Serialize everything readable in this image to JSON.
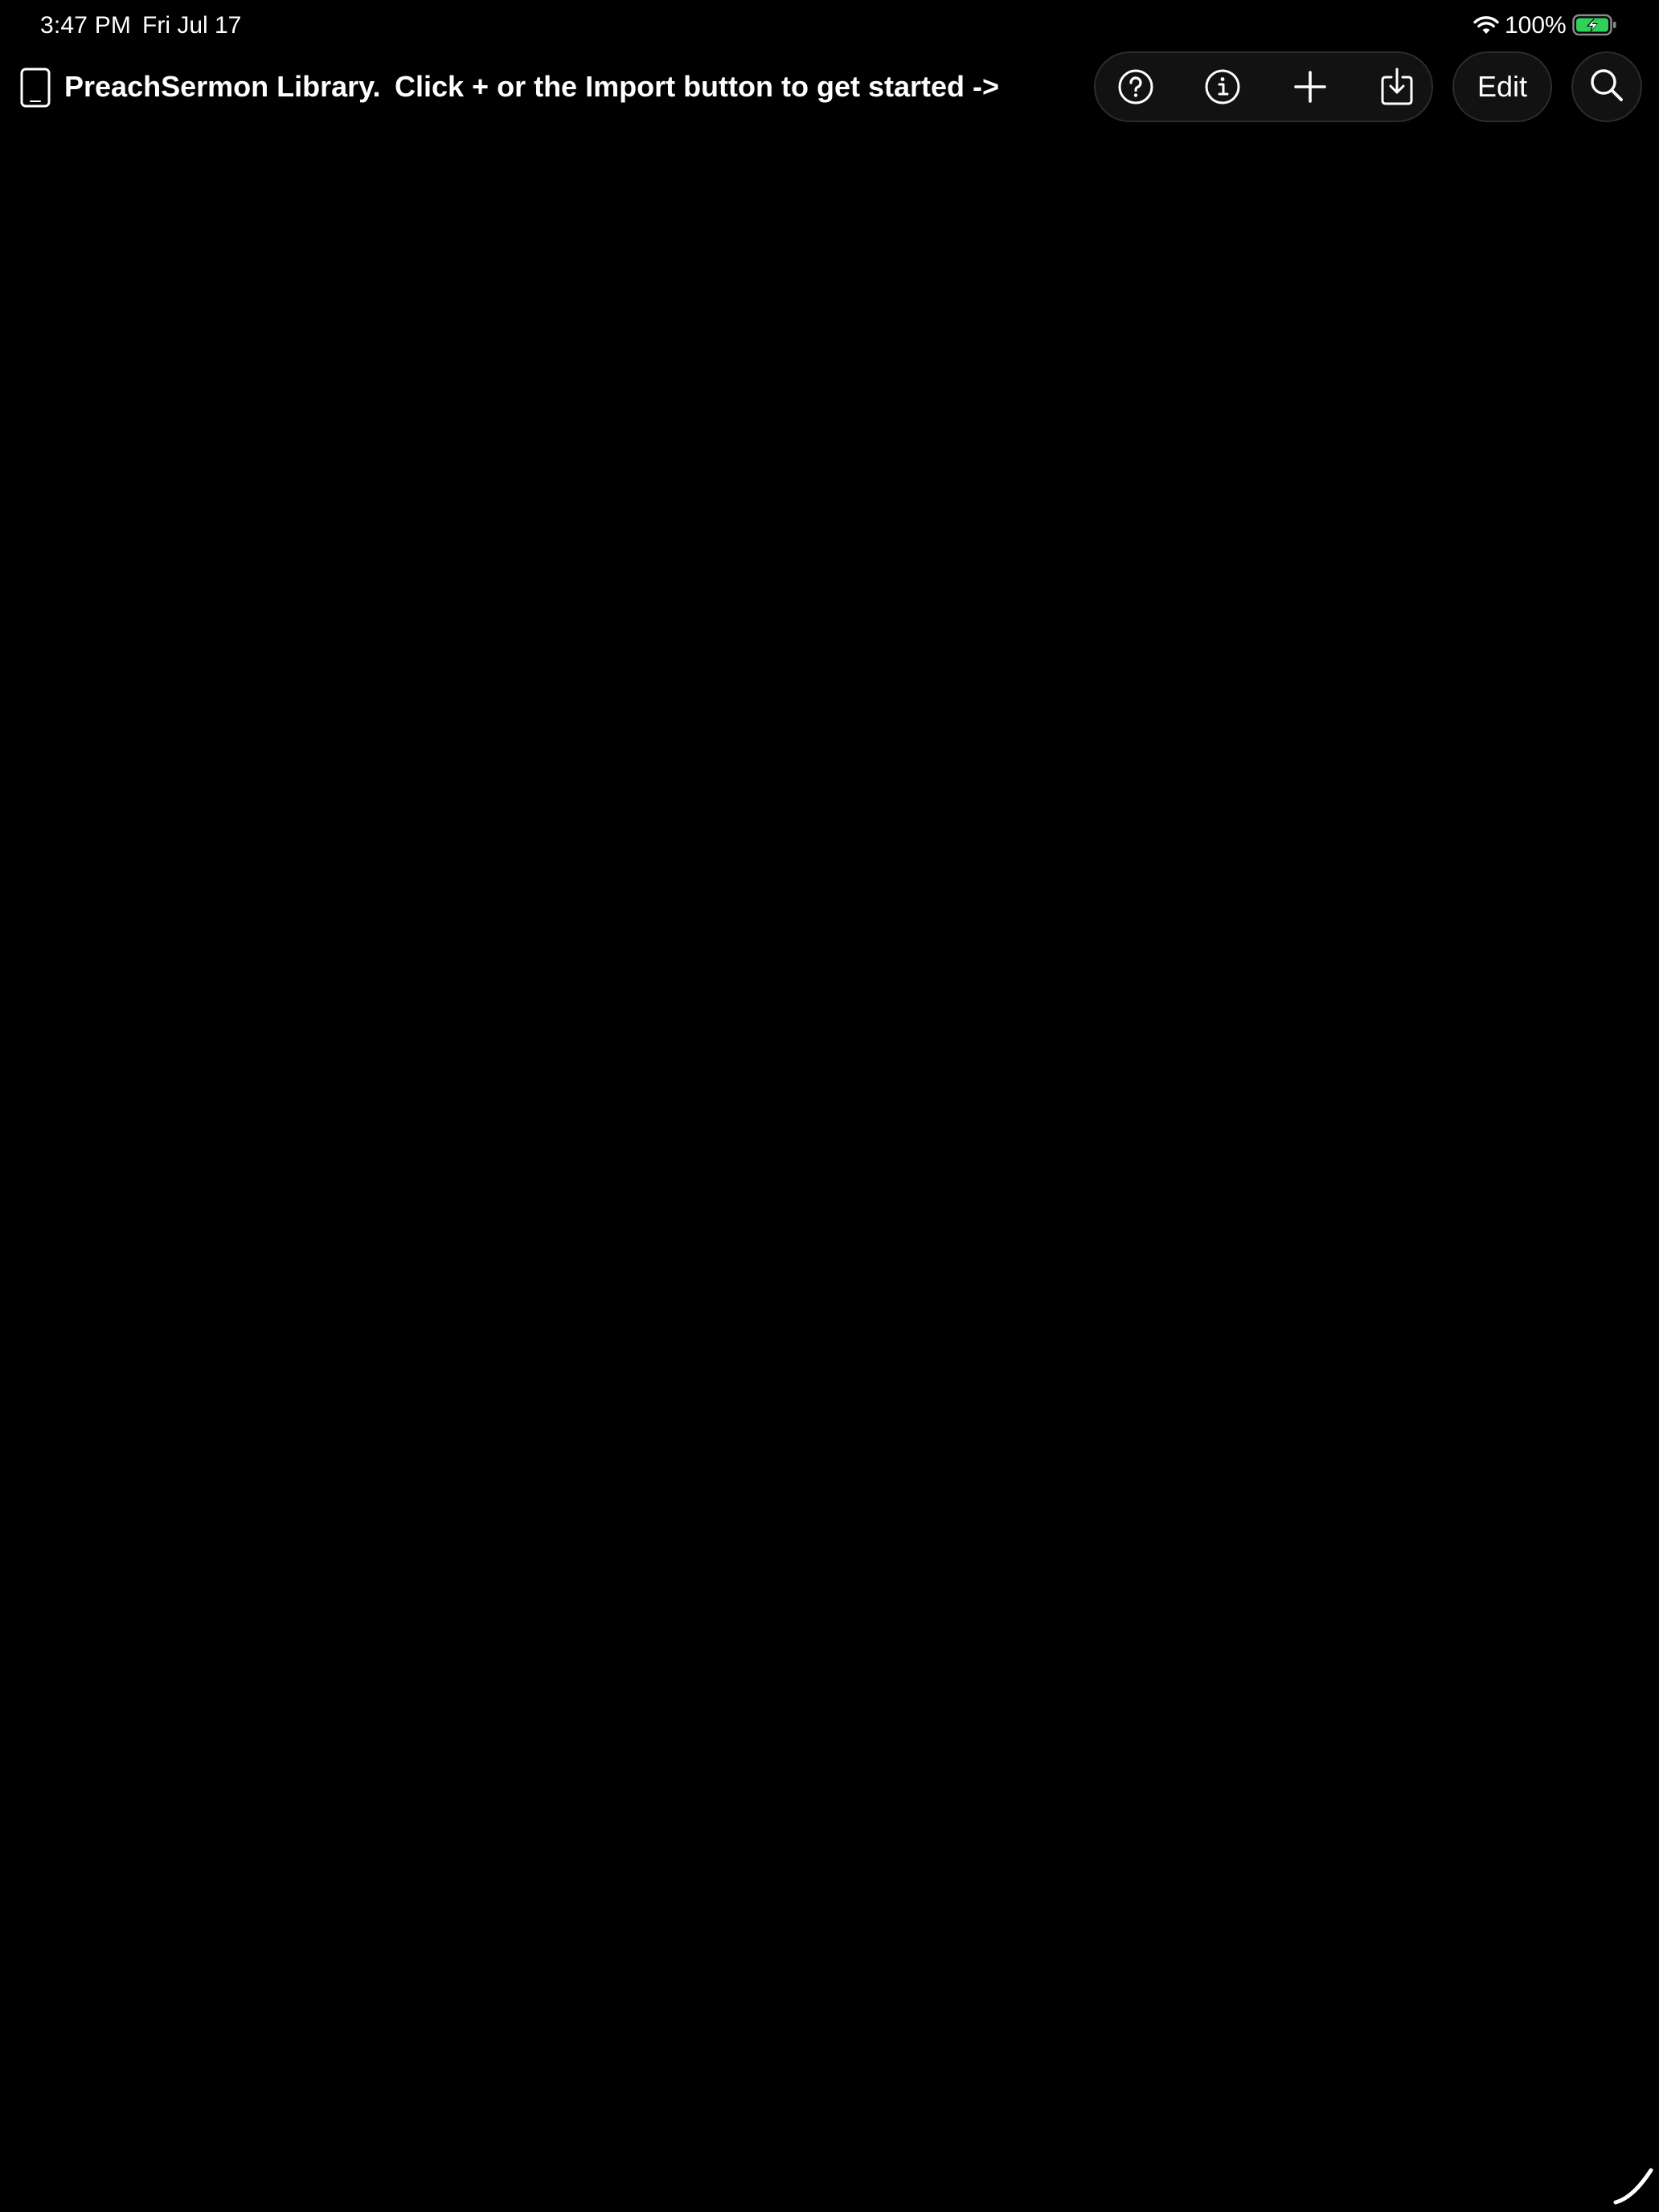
{
  "status_bar": {
    "time": "3:47 PM",
    "date": "Fri Jul 17",
    "battery_percent": "100%",
    "wifi_icon": "wifi-icon",
    "battery_icon": "battery-charging-icon",
    "battery_color": "#30d158"
  },
  "nav": {
    "title": "PreachSermon Library.",
    "hint": "Click + or the Import button to get started ->",
    "device_icon": "ipad-icon"
  },
  "toolbar": {
    "buttons": [
      {
        "icon": "question-circle-icon"
      },
      {
        "icon": "info-circle-icon"
      },
      {
        "icon": "plus-icon"
      },
      {
        "icon": "import-tray-icon"
      }
    ],
    "edit_label": "Edit",
    "search_icon": "magnifying-glass-icon"
  },
  "colors": {
    "background": "#000000",
    "button_fill": "#121212",
    "button_border": "#2c2c2c",
    "text": "#ffffff"
  }
}
